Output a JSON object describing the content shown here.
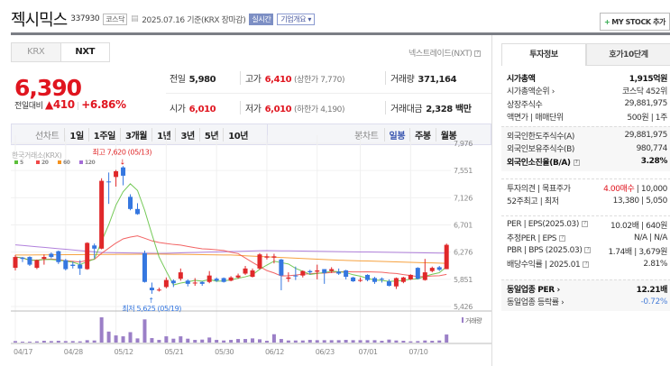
{
  "header": {
    "name": "젝시믹스",
    "code": "337930",
    "market": "코스닥",
    "date": "2025.07.16 기준(KRX 장마감)",
    "realtime": "실시간",
    "corp_info": "기업개요",
    "mystock": "MY STOCK 추가",
    "mystock_icon": "plus-icon"
  },
  "quote": {
    "tabs": [
      "KRX",
      "NXT"
    ],
    "active_tab": "NXT",
    "source_link": "넥스트레이드(NXT)",
    "price": "6,390",
    "change_label": "전일대비",
    "change_arrow": "▲",
    "change": "410",
    "change_pct": "+6.86%",
    "prev_label": "전일",
    "prev": "5,980",
    "high_label": "고가",
    "high": "6,410",
    "upper_label": "(상한가 7,770)",
    "volume_label": "거래량",
    "volume": "371,164",
    "open_label": "시가",
    "open": "6,010",
    "low_label": "저가",
    "low": "6,010",
    "lower_label": "(하한가 4,190)",
    "amount_label": "거래대금",
    "amount": "2,328 백만"
  },
  "period": {
    "line_label": "선차트",
    "line_items": [
      "1일",
      "1주일",
      "3개월",
      "1년",
      "3년",
      "5년",
      "10년"
    ],
    "candle_label": "봉차트",
    "candle_items": [
      "일봉",
      "주봉",
      "월봉"
    ],
    "active": "일봉"
  },
  "chart_data": {
    "type": "candlestick",
    "source": "한국거래소(KRX)",
    "legend": [
      "5",
      "20",
      "60",
      "120"
    ],
    "colors": {
      "ma5": "#5cbf3a",
      "ma20": "#f04848",
      "ma60": "#f5921e",
      "ma120": "#a36bd6",
      "up": "#e0282a",
      "down": "#3577e0",
      "volume": "#9b7fc7"
    },
    "yticks": [
      "7,976",
      "7,551",
      "7,126",
      "6,701",
      "6,276",
      "5,851",
      "5,426"
    ],
    "ylim": [
      5426,
      7976
    ],
    "xlabels": [
      {
        "i": 0,
        "t": "04/17"
      },
      {
        "i": 7,
        "t": "04/28"
      },
      {
        "i": 14,
        "t": "05/12"
      },
      {
        "i": 21,
        "t": "05/21"
      },
      {
        "i": 28,
        "t": "05/30"
      },
      {
        "i": 35,
        "t": "06/12"
      },
      {
        "i": 42,
        "t": "06/23"
      },
      {
        "i": 48,
        "t": "07/01"
      },
      {
        "i": 55,
        "t": "07/10"
      }
    ],
    "high_note": "최고 7,620 (05/13)",
    "high_index": 15,
    "high_value": 7620,
    "low_note": "최저 5,625 (05/19)",
    "low_index": 19,
    "low_value": 5625,
    "volume_label": "거래량",
    "ohlc": [
      [
        6030,
        6230,
        5990,
        6200
      ],
      [
        6190,
        6200,
        6120,
        6170
      ],
      [
        6200,
        6210,
        6060,
        6080
      ],
      [
        6030,
        6160,
        6010,
        6150
      ],
      [
        6170,
        6240,
        6080,
        6200
      ],
      [
        6250,
        6270,
        6180,
        6200
      ],
      [
        6290,
        6300,
        6090,
        6120
      ],
      [
        6150,
        6170,
        5990,
        6010
      ],
      [
        6080,
        6130,
        6020,
        6060
      ],
      [
        6080,
        6150,
        5920,
        6020
      ],
      [
        6010,
        6430,
        6000,
        6420
      ],
      [
        6380,
        6410,
        6180,
        6330
      ],
      [
        6330,
        7430,
        6320,
        7390
      ],
      [
        7380,
        7520,
        7030,
        7370
      ],
      [
        7450,
        7560,
        7300,
        7540
      ],
      [
        7600,
        7620,
        7320,
        7470
      ],
      [
        7140,
        7180,
        6930,
        6950
      ],
      [
        6950,
        7040,
        6860,
        6870
      ],
      [
        6260,
        6300,
        5800,
        5810
      ],
      [
        5720,
        5800,
        5625,
        5680
      ],
      [
        5680,
        5720,
        5660,
        5690
      ],
      [
        5730,
        5880,
        5710,
        5840
      ],
      [
        5830,
        5850,
        5730,
        5790
      ],
      [
        5860,
        6020,
        5830,
        5960
      ],
      [
        5830,
        5850,
        5740,
        5780
      ],
      [
        5790,
        5870,
        5750,
        5800
      ],
      [
        5810,
        5820,
        5750,
        5780
      ],
      [
        5810,
        5980,
        5790,
        5910
      ],
      [
        5860,
        5880,
        5810,
        5830
      ],
      [
        5870,
        5880,
        5800,
        5810
      ],
      [
        5830,
        5900,
        5820,
        5880
      ],
      [
        5880,
        5940,
        5860,
        5910
      ],
      [
        5940,
        6060,
        5920,
        6020
      ],
      [
        5890,
        6020,
        5880,
        5990
      ],
      [
        6020,
        6260,
        6000,
        6240
      ],
      [
        6190,
        6250,
        6160,
        6210
      ],
      [
        6190,
        6250,
        6100,
        6210
      ],
      [
        6160,
        6170,
        5680,
        5910
      ],
      [
        5860,
        5960,
        5810,
        5880
      ],
      [
        5910,
        6050,
        5840,
        5900
      ],
      [
        5910,
        5990,
        5880,
        5980
      ],
      [
        5980,
        6000,
        5930,
        5960
      ],
      [
        5970,
        6080,
        5850,
        5990
      ],
      [
        6010,
        6010,
        5780,
        5950
      ],
      [
        5980,
        6040,
        5950,
        6010
      ],
      [
        5970,
        6020,
        5920,
        5940
      ],
      [
        5990,
        6000,
        5850,
        5890
      ],
      [
        5880,
        5890,
        5810,
        5820
      ],
      [
        5830,
        5880,
        5810,
        5840
      ],
      [
        5920,
        5930,
        5820,
        5840
      ],
      [
        5870,
        5890,
        5780,
        5810
      ],
      [
        5860,
        5880,
        5800,
        5850
      ],
      [
        5820,
        5850,
        5740,
        5750
      ],
      [
        5740,
        5880,
        5700,
        5870
      ],
      [
        5810,
        5890,
        5790,
        5880
      ],
      [
        5850,
        5930,
        5840,
        5920
      ],
      [
        6030,
        6040,
        5850,
        5860
      ],
      [
        5840,
        6170,
        5830,
        5960
      ],
      [
        5980,
        6050,
        5960,
        6030
      ],
      [
        6040,
        6060,
        5980,
        6000
      ],
      [
        6010,
        6410,
        6010,
        6390
      ]
    ],
    "ma60_keypoints": [
      [
        0,
        6230
      ],
      [
        20,
        6245
      ],
      [
        30,
        6230
      ],
      [
        45,
        6150
      ],
      [
        60,
        6100
      ]
    ],
    "ma120_keypoints": [
      [
        0,
        6390
      ],
      [
        12,
        6270
      ],
      [
        20,
        6255
      ],
      [
        35,
        6300
      ],
      [
        60,
        6260
      ]
    ],
    "volume_k": [
      68,
      41,
      41,
      55,
      82,
      68,
      82,
      68,
      68,
      55,
      110,
      96,
      1164,
      507,
      329,
      288,
      480,
      192,
      1069,
      206,
      123,
      288,
      178,
      288,
      178,
      123,
      137,
      233,
      123,
      96,
      123,
      164,
      164,
      192,
      151,
      82,
      384,
      164,
      96,
      96,
      96,
      123,
      110,
      110,
      110,
      110,
      123,
      110,
      110,
      110,
      110,
      82,
      137,
      96,
      82,
      55,
      68,
      96,
      82,
      96,
      371
    ]
  },
  "invest": {
    "tabs": [
      "투자정보",
      "호가10단계"
    ],
    "g1": [
      {
        "k": "시가총액",
        "v": "1,915억원",
        "bold": true
      },
      {
        "k": "시가총액순위 ›",
        "v": "코스닥 452위"
      },
      {
        "k": "상장주식수",
        "v": "29,881,975"
      },
      {
        "k": "액면가 | 매매단위",
        "v": "500원 | 1주"
      }
    ],
    "g2": [
      {
        "k": "외국인한도주식수(A)",
        "v": "29,881,975"
      },
      {
        "k": "외국인보유주식수(B)",
        "v": "980,774"
      },
      {
        "k": "외국인소진율(B/A)",
        "v": "3.28%",
        "bold": true,
        "help": true
      }
    ],
    "g3": [
      {
        "k": "투자의견 | 목표주가",
        "v1": "4.00매수",
        "v": " | 10,000"
      },
      {
        "k": "52주최고 | 최저",
        "v": "13,380 | 5,050"
      }
    ],
    "g4": [
      {
        "k": "PER | EPS(2025.03)",
        "v": "10.02배 | 640원",
        "help": true
      },
      {
        "k": "추정PER | EPS",
        "v": "N/A | N/A",
        "help": true
      },
      {
        "k": "PBR | BPS (2025.03)",
        "v": "1.74배 | 3,679원",
        "help": true
      },
      {
        "k": "배당수익률 | 2025.01",
        "v": "2.81%",
        "help": true
      }
    ],
    "g5": [
      {
        "k": "동일업종 PER ›",
        "v": "12.21배",
        "bold": true
      },
      {
        "k": "동일업종 등락률 ›",
        "v": "-0.72%",
        "blue": true
      }
    ]
  }
}
